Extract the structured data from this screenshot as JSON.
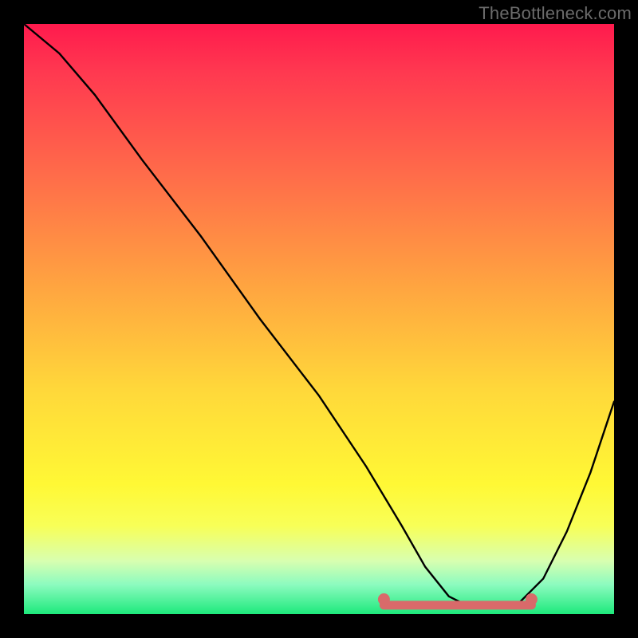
{
  "watermark": "TheBottleneck.com",
  "chart_data": {
    "type": "line",
    "title": "",
    "xlabel": "",
    "ylabel": "",
    "xlim": [
      0,
      100
    ],
    "ylim": [
      0,
      100
    ],
    "series": [
      {
        "name": "bottleneck-curve",
        "x": [
          0,
          6,
          12,
          20,
          30,
          40,
          50,
          58,
          64,
          68,
          72,
          76,
          80,
          84,
          88,
          92,
          96,
          100
        ],
        "values": [
          100,
          95,
          88,
          77,
          64,
          50,
          37,
          25,
          15,
          8,
          3,
          1,
          1,
          2,
          6,
          14,
          24,
          36
        ]
      }
    ],
    "markers": [
      {
        "name": "flat-band-left-dot",
        "x": 61,
        "y": 2.5
      },
      {
        "name": "flat-band-right-dot",
        "x": 86,
        "y": 2.5
      }
    ],
    "flat_band": {
      "x_start": 61,
      "x_end": 86,
      "y": 1.5
    },
    "colors": {
      "curve": "#000000",
      "markers": "#d96a6a",
      "band": "#d96a6a"
    }
  }
}
